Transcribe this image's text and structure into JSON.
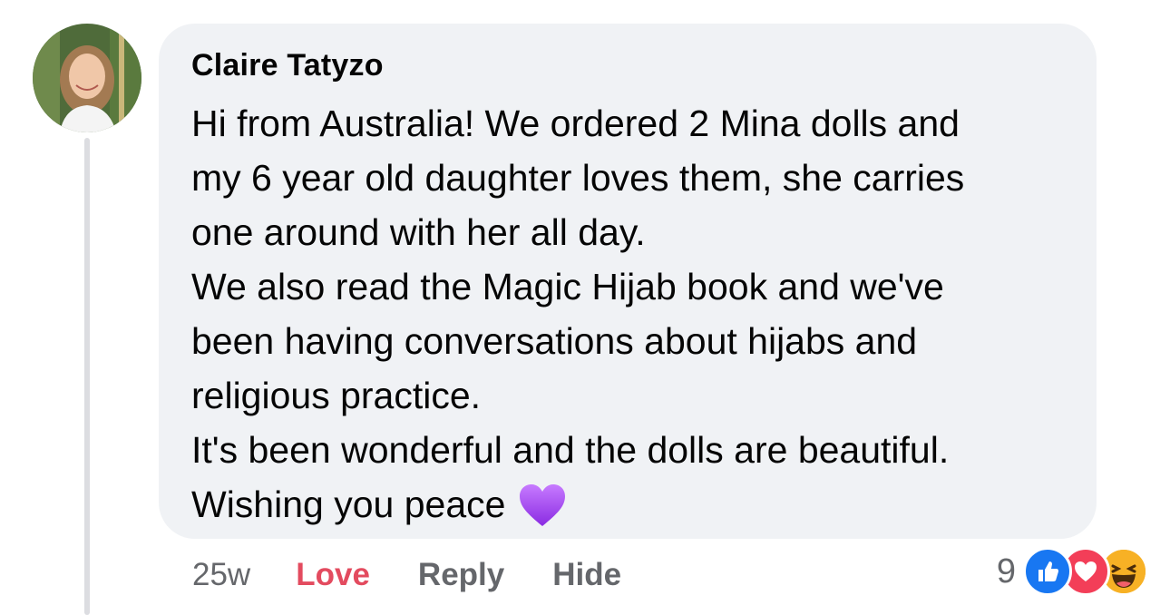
{
  "comment": {
    "author": "Claire Tatyzo",
    "body_lines": [
      "Hi from Australia! We ordered 2 Mina dolls and",
      "my 6 year old daughter loves them, she carries",
      "one around with her all day.",
      "We also read the Magic Hijab book and we've",
      "been having conversations about hijabs and",
      "religious practice.",
      "It's been wonderful and the dolls are beautiful.",
      "Wishing you peace"
    ],
    "emoji": "purple-heart-icon"
  },
  "actions": {
    "timestamp": "25w",
    "love_label": "Love",
    "reply_label": "Reply",
    "hide_label": "Hide"
  },
  "reactions": {
    "count": "9",
    "types": [
      "like-icon",
      "love-icon",
      "haha-icon"
    ]
  },
  "colors": {
    "bubble_bg": "#f0f2f5",
    "love_active": "#e34b5f",
    "muted_text": "#65676b",
    "like_blue": "#1877f2",
    "love_red": "#f33e58",
    "haha_yellow": "#f7b125"
  }
}
